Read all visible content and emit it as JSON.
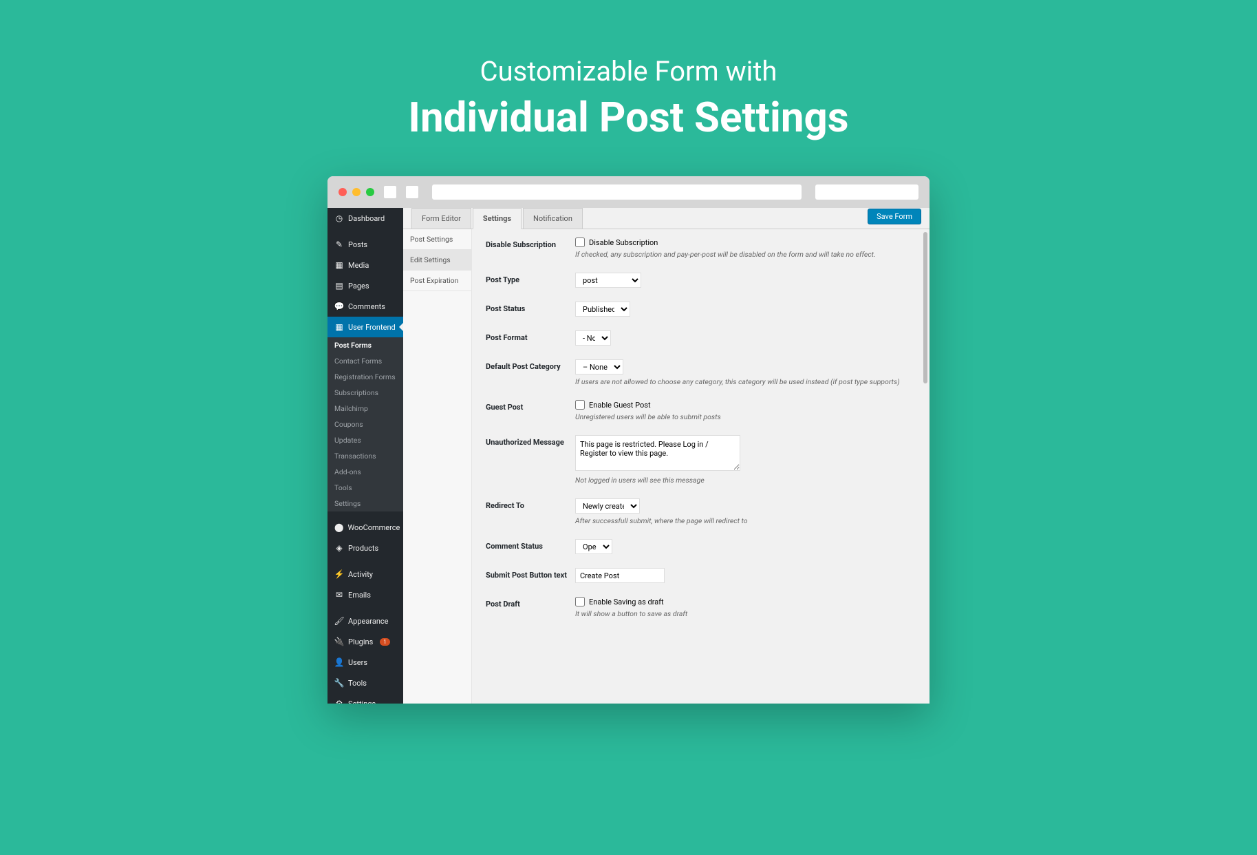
{
  "hero": {
    "subtitle": "Customizable Form with",
    "title": "Individual Post Settings"
  },
  "sidebar": {
    "items": [
      {
        "label": "Dashboard",
        "icon": "◔"
      },
      {
        "label": "Posts",
        "icon": "📌"
      },
      {
        "label": "Media",
        "icon": "🖼"
      },
      {
        "label": "Pages",
        "icon": "▤"
      },
      {
        "label": "Comments",
        "icon": "💬"
      },
      {
        "label": "User Frontend",
        "icon": "▦"
      },
      {
        "label": "WooCommerce",
        "icon": "🛒"
      },
      {
        "label": "Products",
        "icon": "📦"
      },
      {
        "label": "Activity",
        "icon": "⚡"
      },
      {
        "label": "Emails",
        "icon": "✉"
      },
      {
        "label": "Appearance",
        "icon": "🖌"
      },
      {
        "label": "Plugins",
        "icon": "🔌"
      },
      {
        "label": "Users",
        "icon": "👤"
      },
      {
        "label": "Tools",
        "icon": "🔧"
      },
      {
        "label": "Settings",
        "icon": "⚙"
      }
    ],
    "submenu": [
      "Post Forms",
      "Contact Forms",
      "Registration Forms",
      "Subscriptions",
      "Mailchimp",
      "Coupons",
      "Updates",
      "Transactions",
      "Add-ons",
      "Tools",
      "Settings"
    ],
    "plugins_badge": "1"
  },
  "tabs": [
    "Form Editor",
    "Settings",
    "Notification"
  ],
  "save_button": "Save Form",
  "subnav": [
    "Post Settings",
    "Edit Settings",
    "Post Expiration"
  ],
  "form": {
    "disable_sub": {
      "label": "Disable Subscription",
      "cb": "Disable Subscription",
      "help": "If checked, any subscription and pay-per-post will be disabled on the form and will take no effect."
    },
    "post_type": {
      "label": "Post Type",
      "value": "post"
    },
    "post_status": {
      "label": "Post Status",
      "value": "Published"
    },
    "post_format": {
      "label": "Post Format",
      "value": "- None -"
    },
    "default_cat": {
      "label": "Default Post Category",
      "value": "– None –",
      "help": "If users are not allowed to choose any category, this category will be used instead (if post type supports)"
    },
    "guest_post": {
      "label": "Guest Post",
      "cb": "Enable Guest Post",
      "help": "Unregistered users will be able to submit posts"
    },
    "unauth": {
      "label": "Unauthorized Message",
      "value": "This page is restricted. Please Log in / Register to view this page.",
      "help": "Not logged in users will see this message"
    },
    "redirect": {
      "label": "Redirect To",
      "value": "Newly created post",
      "help": "After successfull submit, where the page will redirect to"
    },
    "comment": {
      "label": "Comment Status",
      "value": "Open"
    },
    "submit_btn": {
      "label": "Submit Post Button text",
      "value": "Create Post"
    },
    "draft": {
      "label": "Post Draft",
      "cb": "Enable Saving as draft",
      "help": "It will show a button to save as draft"
    }
  }
}
